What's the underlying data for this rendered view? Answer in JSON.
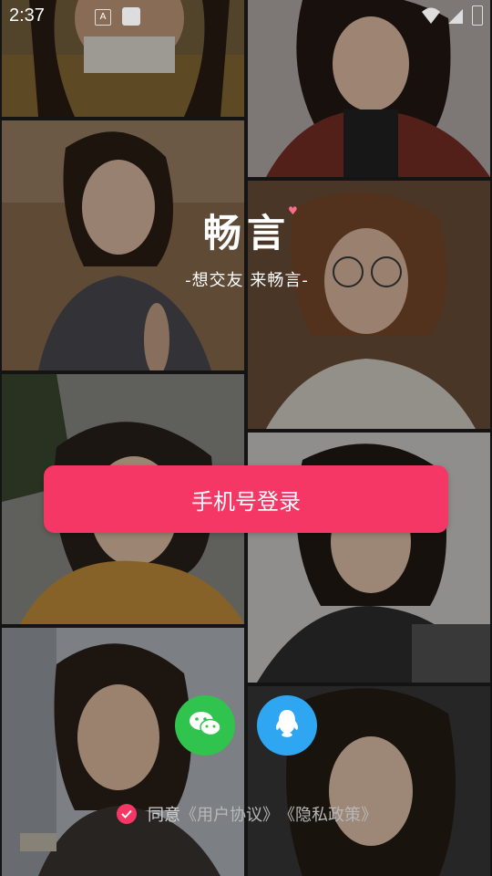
{
  "status_bar": {
    "time": "2:37",
    "notif_letter": "A"
  },
  "brand": {
    "name": "畅言",
    "slogan": "-想交友 来畅言-"
  },
  "login": {
    "phone_login_label": "手机号登录"
  },
  "social": {
    "wechat_icon": "wechat-icon",
    "qq_icon": "qq-icon"
  },
  "agreement": {
    "prefix": "同意",
    "user_agreement": "《用户协议》",
    "privacy_policy": "《隐私政策》"
  },
  "colors": {
    "accent": "#f43764",
    "wechat": "#30c34e",
    "qq": "#2fa6f2"
  }
}
